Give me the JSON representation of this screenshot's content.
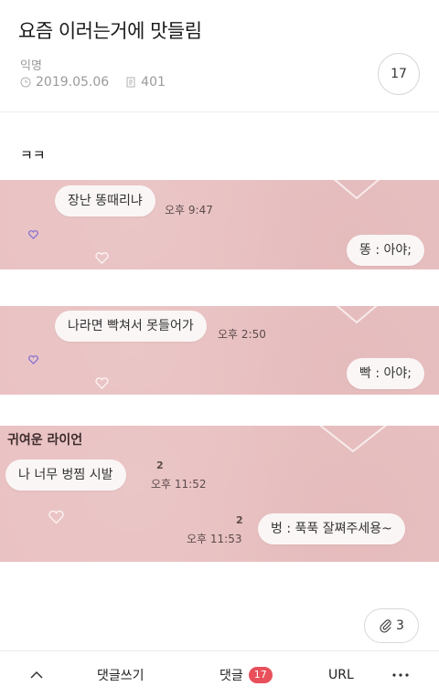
{
  "post": {
    "title": "요즘 이러는거에 맛들림",
    "author": "익명",
    "date": "2019.05.06",
    "views": "401",
    "comment_count": "17",
    "body": "ㅋㅋ"
  },
  "chat1": {
    "msg1": "장난 똥때리냐",
    "time1": "오후 9:47",
    "reply": "똥 : 아야;"
  },
  "chat2": {
    "msg1": "나라면 빡쳐서 못들어가",
    "time1": "오후 2:50",
    "reply": "빡 : 아야;"
  },
  "chat3": {
    "sender": "귀여운 라이언",
    "msg1": "나 너무 벙찜 시발",
    "unread1": "2",
    "time1": "오후 11:52",
    "unread2": "2",
    "time2": "오후 11:53",
    "reply": "벙 : 푹푹 잘쪄주세용~"
  },
  "attachments": {
    "count": "3",
    "icon": "paperclip-icon"
  },
  "bottom_bar": {
    "up_icon": "chevron-up-icon",
    "write_comment": "댓글쓰기",
    "comments": "댓글",
    "comments_badge": "17",
    "url": "URL",
    "more_icon": "more-icon"
  },
  "colors": {
    "panel": "#e9c1c2",
    "badge": "#e8505b"
  }
}
